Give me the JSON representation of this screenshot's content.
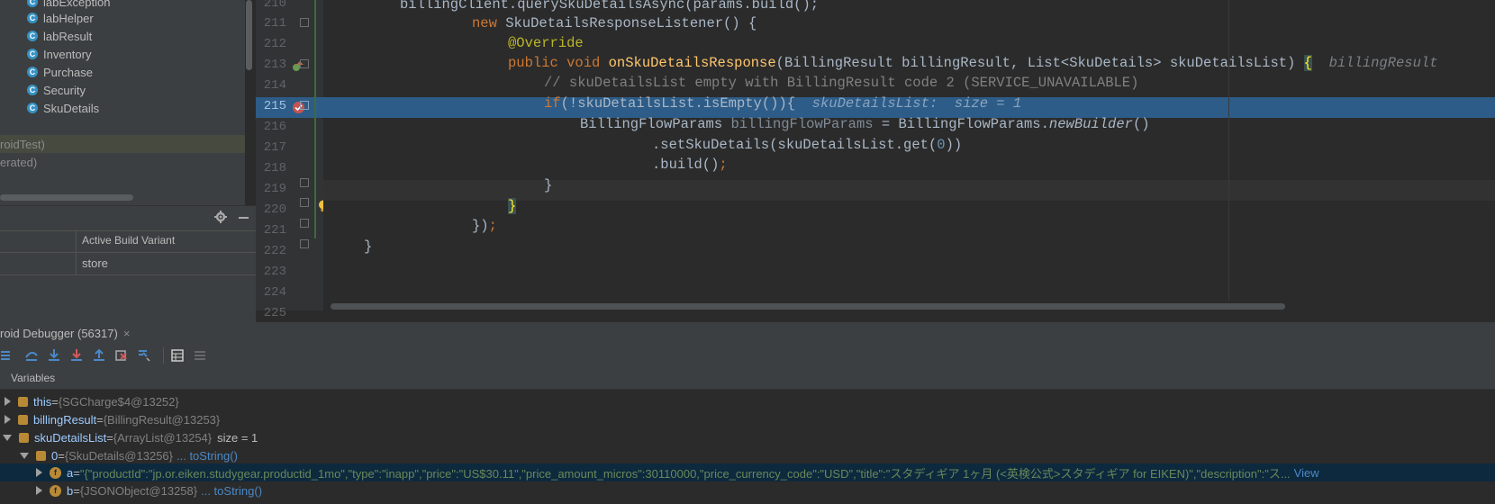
{
  "project_tree": {
    "classes": [
      "labException",
      "labHelper",
      "labResult",
      "Inventory",
      "Purchase",
      "Security",
      "SkuDetails"
    ],
    "groups": [
      "roidTest)",
      "erated)"
    ]
  },
  "build_variants": {
    "column_header": "Active Build Variant",
    "value": "store"
  },
  "editor": {
    "line_numbers": [
      "210",
      "211",
      "212",
      "213",
      "214",
      "215",
      "216",
      "217",
      "218",
      "219",
      "220",
      "221",
      "222",
      "223",
      "224",
      "225"
    ],
    "l210": "billingClient.querySkuDetailsAsync(params.build();",
    "l211_kw": "new ",
    "l211_rest": "SkuDetailsResponseListener() {",
    "l212": "@Override",
    "l213_kw": "public void ",
    "l213_fn": "onSkuDetailsResponse",
    "l213_p1": "(BillingResult billingResult, List<SkuDetails> skuDetailsList) ",
    "l213_brace": "{",
    "l213_hint": "billingResult",
    "l214": "// skuDetailsList empty with BillingResult code 2 (SERVICE_UNAVAILABLE)",
    "l215_kw": "if",
    "l215_rest": "(!skuDetailsList.isEmpty()){",
    "l215_hint": "skuDetailsList:  size = 1",
    "l216_a": "BillingFlowParams ",
    "l216_b": "billingFlowParams",
    "l216_c": " = BillingFlowParams.",
    "l216_d": "newBuilder",
    "l216_e": "()",
    "l217_a": ".setSkuDetails(skuDetailsList.get(",
    "l217_num": "0",
    "l217_b": "))",
    "l218_a": ".build()",
    "l218_b": ";",
    "l219": "}",
    "l220": "}",
    "l221_a": "})",
    "l221_b": ";",
    "l222": "}"
  },
  "debugger": {
    "tab_title": "roid Debugger (56317)",
    "close": "×",
    "variables_label": "Variables",
    "vars": [
      {
        "name": "this",
        "eq": " = ",
        "type": "{SGCharge$4@13252}"
      },
      {
        "name": "billingResult",
        "eq": " = ",
        "type": "{BillingResult@13253}"
      },
      {
        "name": "skuDetailsList",
        "eq": " = ",
        "type": "{ArrayList@13254}",
        "extra": "size = 1"
      },
      {
        "name": "0",
        "eq": " = ",
        "type": "{SkuDetails@13256}",
        "link": "... toString()"
      },
      {
        "name": "a",
        "eq": " = ",
        "value": "\"{\"productId\":\"jp.or.eiken.studygear.productid_1mo\",\"type\":\"inapp\",\"price\":\"US$30.11\",\"price_amount_micros\":30110000,\"price_currency_code\":\"USD\",\"title\":\"スタディギア 1ヶ月 (<英検公式>スタディギア for EIKEN)\",\"description\":\"ス...",
        "link": "View"
      },
      {
        "name": "b",
        "eq": " = ",
        "type": "{JSONObject@13258}",
        "link": "... toString()"
      }
    ]
  },
  "colors": {
    "selection": "#2d5c88",
    "keyword": "#cc7832",
    "annotation": "#bbb529",
    "method": "#ffc66d"
  }
}
